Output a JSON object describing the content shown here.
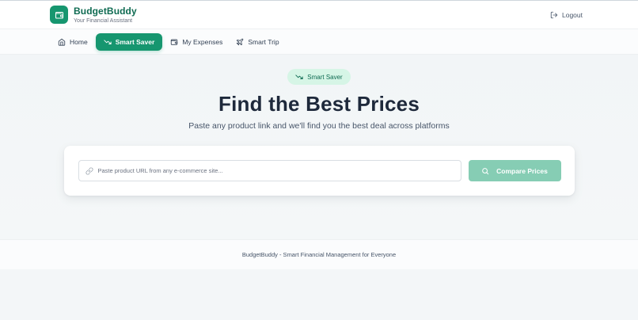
{
  "brand": {
    "name": "BudgetBuddy",
    "tagline": "Your Financial Assistant",
    "icon": "wallet-icon"
  },
  "header": {
    "logout_label": "Logout",
    "logout_icon": "logout-icon"
  },
  "nav": {
    "items": [
      {
        "label": "Home",
        "icon": "home-icon",
        "active": false
      },
      {
        "label": "Smart Saver",
        "icon": "trending-down-icon",
        "active": true
      },
      {
        "label": "My Expenses",
        "icon": "wallet-icon",
        "active": false
      },
      {
        "label": "Smart Trip",
        "icon": "plane-icon",
        "active": false
      }
    ]
  },
  "hero": {
    "badge_label": "Smart Saver",
    "badge_icon": "trending-down-icon",
    "title": "Find the Best Prices",
    "subtitle": "Paste any product link and we'll find you the best deal across platforms"
  },
  "search": {
    "placeholder": "Paste product URL from any e-commerce site...",
    "value": "",
    "button_label": "Compare Prices",
    "button_icon": "search-icon"
  },
  "footer": {
    "text": "BudgetBuddy - Smart Financial Management for Everyone"
  },
  "colors": {
    "brand_green": "#16966f",
    "brand_dark": "#0f6b52",
    "badge_bg": "#d6f5e6",
    "button_disabled": "#86cdb4",
    "title": "#1e293b"
  }
}
